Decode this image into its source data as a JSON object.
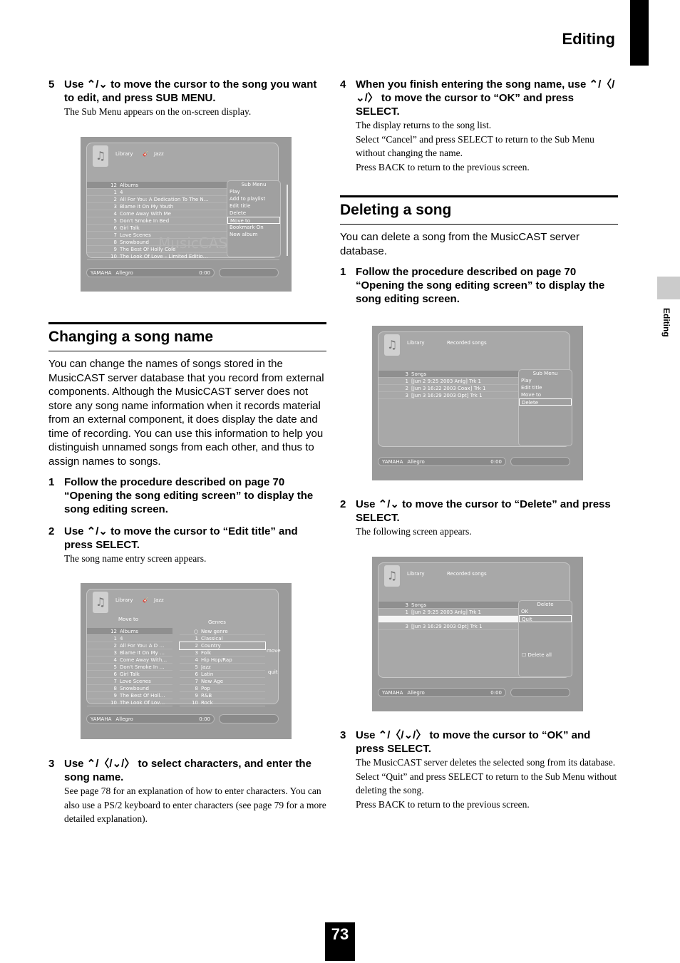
{
  "header": {
    "section_title": "Editing",
    "side_label": "Editing",
    "page_number": "73"
  },
  "left": {
    "step5": {
      "num": "5",
      "text": "Use ⌃/⌄ to move the cursor to the song you want to edit, and press SUB MENU.",
      "note": "The Sub Menu appears on the on-screen display."
    },
    "screen1": {
      "crumb1": "Library",
      "crumb2": "Jazz",
      "rows": [
        {
          "n": "12",
          "t": "Albums"
        },
        {
          "n": "1",
          "t": "4"
        },
        {
          "n": "2",
          "t": "All For You: A Dedication To The N…"
        },
        {
          "n": "3",
          "t": "Blame It On My Youth"
        },
        {
          "n": "4",
          "t": "Come Away With Me"
        },
        {
          "n": "5",
          "t": "Don't Smoke In Bed"
        },
        {
          "n": "6",
          "t": "Girl Talk"
        },
        {
          "n": "7",
          "t": "Love Scenes"
        },
        {
          "n": "8",
          "t": "Snowbound"
        },
        {
          "n": "9",
          "t": "The Best Of Holly Cole"
        },
        {
          "n": "10",
          "t": "The Look Of Love – Limited Editio…"
        }
      ],
      "submenu_title": "Sub Menu",
      "submenu": [
        "Play",
        "Add to playlist",
        "Edit title",
        "Delete",
        "Move to",
        "Bookmark On",
        "New album"
      ],
      "submenu_selected": "Move to",
      "footer_brand": "YAMAHA",
      "footer_track": "Allegro",
      "footer_time": "0:00",
      "watermark": "MusicCAST"
    },
    "section_title": "Changing a song name",
    "intro": "You can change the names of songs stored in the MusicCAST server database that you record from external components. Although the MusicCAST server does not store any song name information when it records material from an external component, it does display the date and time of recording. You can use this information to help you distinguish unnamed songs from each other, and thus to assign names to songs.",
    "step1": {
      "num": "1",
      "text": "Follow the procedure described on page 70 “Opening the song editing screen” to display the song editing screen."
    },
    "step2": {
      "num": "2",
      "text": "Use ⌃/⌄ to move the cursor to “Edit title” and press SELECT.",
      "note": "The song name entry screen appears."
    },
    "screen2": {
      "crumb1": "Library",
      "crumb2": "Jazz",
      "move_to": "Move to",
      "genres_header": "Genres",
      "rows": [
        {
          "n": "12",
          "t": "Albums"
        },
        {
          "n": "1",
          "t": "4"
        },
        {
          "n": "2",
          "t": "All For You: A D …"
        },
        {
          "n": "3",
          "t": "Blame It On My …"
        },
        {
          "n": "4",
          "t": "Come Away With…"
        },
        {
          "n": "5",
          "t": "Don't Smoke In …"
        },
        {
          "n": "6",
          "t": "Girl Talk"
        },
        {
          "n": "7",
          "t": "Love Scenes"
        },
        {
          "n": "8",
          "t": "Snowbound"
        },
        {
          "n": "9",
          "t": "The Best Of Holl…"
        },
        {
          "n": "10",
          "t": "The Look Of Lov…"
        }
      ],
      "genres": [
        {
          "n": "○",
          "t": "New genre"
        },
        {
          "n": "1",
          "t": "Classical"
        },
        {
          "n": "2",
          "t": "Country"
        },
        {
          "n": "3",
          "t": "Folk"
        },
        {
          "n": "4",
          "t": "Hip Hop/Rap"
        },
        {
          "n": "5",
          "t": "Jazz"
        },
        {
          "n": "6",
          "t": "Latin"
        },
        {
          "n": "7",
          "t": "New Age"
        },
        {
          "n": "8",
          "t": "Pop"
        },
        {
          "n": "9",
          "t": "R&B"
        },
        {
          "n": "10",
          "t": "Rock"
        }
      ],
      "genre_selected": "Country",
      "move_label": "move",
      "quit_label": "quit",
      "footer_brand": "YAMAHA",
      "footer_track": "Allegro",
      "footer_time": "0:00"
    },
    "step3": {
      "num": "3",
      "text": "Use ⌃/〈/⌄/〉 to select characters, and enter the song name.",
      "note": "See page 78 for an explanation of how to enter characters. You can also use a PS/2 keyboard to enter characters (see page 79 for a more detailed explanation)."
    }
  },
  "right": {
    "step4": {
      "num": "4",
      "text": "When you finish entering the song name, use ⌃/〈/⌄/〉 to move the cursor to “OK” and press SELECT.",
      "note1": "The display returns to the song list.",
      "note2": "Select “Cancel” and press SELECT to return to the Sub Menu without changing the name.",
      "note3": "Press BACK to return to the previous screen."
    },
    "section_title": "Deleting a song",
    "intro": "You can delete a song from the MusicCAST server database.",
    "step1": {
      "num": "1",
      "text": "Follow the procedure described on page 70 “Opening the song editing screen” to display the song editing screen."
    },
    "screen3": {
      "crumb1": "Library",
      "crumb2": "Recorded songs",
      "rows": [
        {
          "n": "3",
          "t": "Songs"
        },
        {
          "n": "1",
          "t": "[Jun  2  9:25 2003 Anlg] Trk 1"
        },
        {
          "n": "2",
          "t": "[Jun  3 16:22 2003 Coax] Trk 1"
        },
        {
          "n": "3",
          "t": "[Jun  3 16:29 2003 Opt] Trk 1"
        }
      ],
      "submenu_title": "Sub Menu",
      "submenu": [
        "Play",
        "Edit title",
        "Move to",
        "Delete"
      ],
      "submenu_selected": "Delete",
      "footer_brand": "YAMAHA",
      "footer_track": "Allegro",
      "footer_time": "0:00"
    },
    "step2": {
      "num": "2",
      "text": "Use ⌃/⌄ to move the cursor to “Delete” and press SELECT.",
      "note": "The following screen appears."
    },
    "screen4": {
      "crumb1": "Library",
      "crumb2": "Recorded songs",
      "rows": [
        {
          "n": "3",
          "t": "Songs"
        },
        {
          "n": "1",
          "t": "[Jun  2  9:25 2003 Anlg] Trk 1"
        },
        {
          "n": "",
          "t": ""
        },
        {
          "n": "3",
          "t": "[Jun  3 16:29 2003 Opt] Trk 1"
        }
      ],
      "delete_title": "Delete",
      "options": [
        "OK",
        "Quit"
      ],
      "option_selected": "Quit",
      "delete_all": "Delete all",
      "footer_brand": "YAMAHA",
      "footer_track": "Allegro",
      "footer_time": "0:00"
    },
    "step3": {
      "num": "3",
      "text": "Use ⌃/〈/⌄/〉 to move the cursor to “OK” and press SELECT.",
      "note1": "The MusicCAST server deletes the selected song from its database.",
      "note2": "Select “Quit” and press SELECT to return to the Sub Menu without deleting the song.",
      "note3": "Press BACK to return to the previous screen."
    }
  }
}
